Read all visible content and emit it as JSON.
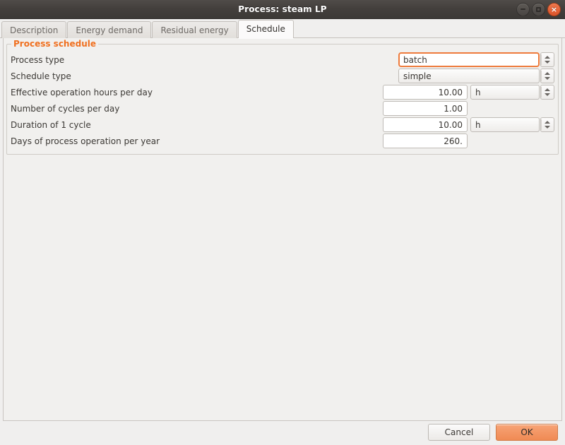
{
  "window": {
    "title": "Process: steam LP",
    "controls": [
      {
        "name": "minimize",
        "icon": "minimize-icon",
        "glyph": ""
      },
      {
        "name": "maximize",
        "icon": "maximize-icon",
        "glyph": ""
      },
      {
        "name": "close",
        "icon": "close-icon",
        "glyph": "×"
      }
    ]
  },
  "tabs": [
    {
      "label": "Description",
      "active": false
    },
    {
      "label": "Energy demand",
      "active": false
    },
    {
      "label": "Residual energy",
      "active": false
    },
    {
      "label": "Schedule",
      "active": true
    }
  ],
  "group": {
    "legend": "Process schedule",
    "legend_color": "#f07020"
  },
  "fields": [
    {
      "label": "Process type",
      "value": "batch",
      "type": "combo",
      "focused": true,
      "has_spinner": true,
      "unit": null
    },
    {
      "label": "Schedule type",
      "value": "simple",
      "type": "combo",
      "focused": false,
      "has_spinner": true,
      "unit": null
    },
    {
      "label": "Effective operation hours per day",
      "value": "10.00",
      "type": "number",
      "focused": false,
      "has_spinner": true,
      "unit": "h"
    },
    {
      "label": "Number of cycles per day",
      "value": "1.00",
      "type": "number",
      "focused": false,
      "has_spinner": false,
      "unit": null
    },
    {
      "label": "Duration of 1 cycle",
      "value": "10.00",
      "type": "number",
      "focused": false,
      "has_spinner": true,
      "unit": "h"
    },
    {
      "label": "Days of process operation per year",
      "value": "260.",
      "type": "number",
      "focused": false,
      "has_spinner": false,
      "unit": null
    }
  ],
  "buttons": {
    "cancel": "Cancel",
    "ok": "OK",
    "ok_color": "#f08a54"
  }
}
